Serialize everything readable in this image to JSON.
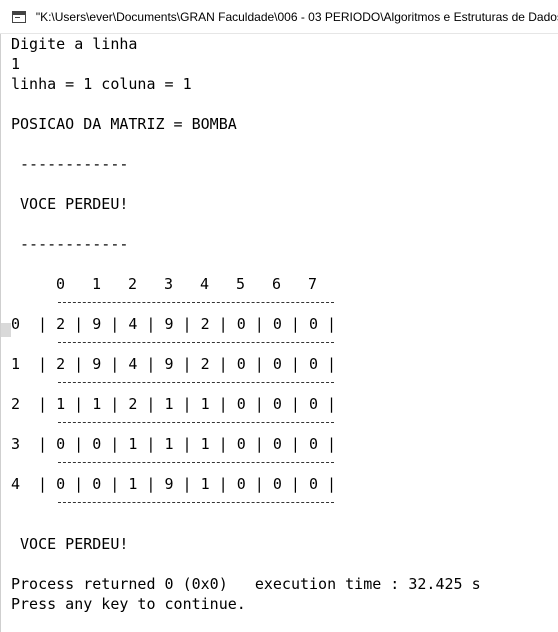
{
  "window": {
    "title": "\"K:\\Users\\ever\\Documents\\GRAN Faculdade\\006 - 03 PERIODO\\Algoritmos e Estruturas de Dados\\"
  },
  "console": {
    "prompt_line": "Digite a linha",
    "input_value": "1",
    "position_line": "linha = 1 coluna = 1",
    "matrix_position_line": "POSICAO DA MATRIZ = BOMBA",
    "separator_top": " ------------",
    "lost_message_1": " VOCE PERDEU!",
    "separator_bottom": " ------------",
    "column_headers": [
      "0",
      "1",
      "2",
      "3",
      "4",
      "5",
      "6",
      "7"
    ],
    "rows": [
      {
        "label": "0",
        "cells": "  | 2 | 9 | 4 | 9 | 2 | 0 | 0 | 0 |"
      },
      {
        "label": "1",
        "cells": "  | 2 | 9 | 4 | 9 | 2 | 0 | 0 | 0 |"
      },
      {
        "label": "2",
        "cells": "  | 1 | 1 | 2 | 1 | 1 | 0 | 0 | 0 |"
      },
      {
        "label": "3",
        "cells": "  | 0 | 0 | 1 | 1 | 1 | 0 | 0 | 0 |"
      },
      {
        "label": "4",
        "cells": "  | 0 | 0 | 1 | 9 | 1 | 0 | 0 | 0 |"
      }
    ],
    "lost_message_2": " VOCE PERDEU!",
    "process_line": "Process returned 0 (0x0)   execution time : 32.425 s",
    "continue_line": "Press any key to continue."
  }
}
